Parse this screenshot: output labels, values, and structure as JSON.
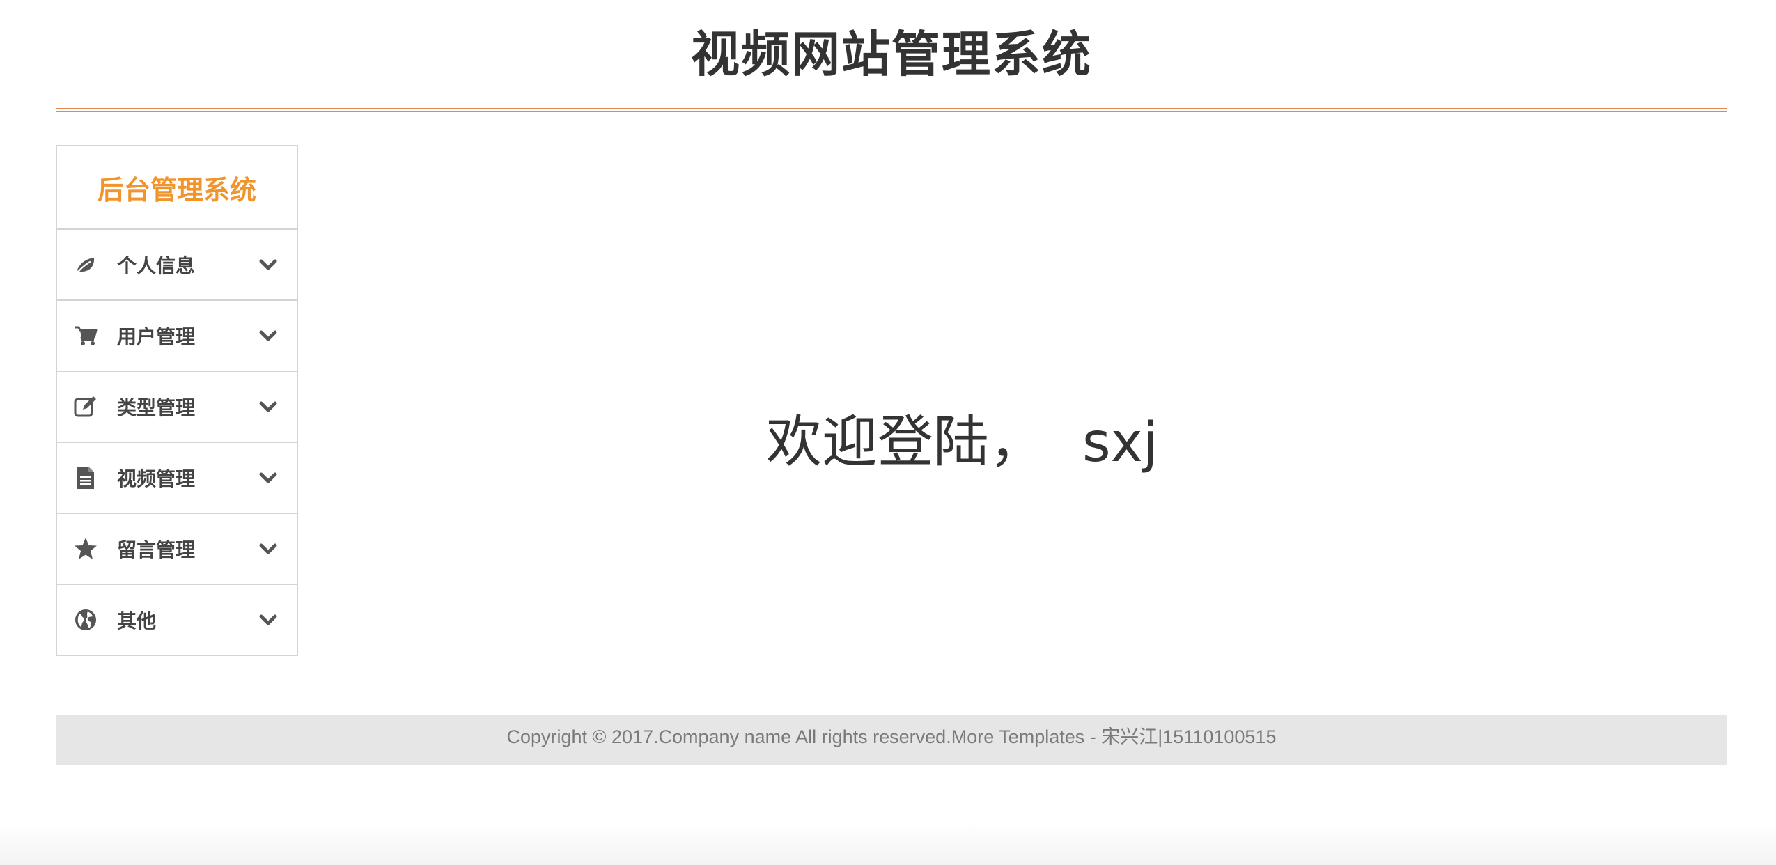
{
  "header": {
    "title": "视频网站管理系统"
  },
  "sidebar": {
    "heading": "后台管理系统",
    "items": [
      {
        "label": "个人信息",
        "icon": "leaf-icon"
      },
      {
        "label": "用户管理",
        "icon": "shopping-cart-icon"
      },
      {
        "label": "类型管理",
        "icon": "edit-icon"
      },
      {
        "label": "视频管理",
        "icon": "file-text-icon"
      },
      {
        "label": "留言管理",
        "icon": "star-icon"
      },
      {
        "label": "其他",
        "icon": "globe-icon"
      }
    ]
  },
  "main": {
    "welcome_text": "欢迎登陆，",
    "username": "sxj"
  },
  "footer": {
    "copyright": "Copyright © 2017.Company name All rights reserved.More Templates - 宋兴江|15110100515"
  },
  "colors": {
    "accent": "#f0952d",
    "header_rule": "#e8874e",
    "footer_bg": "#e6e6e6",
    "icon": "#555555"
  }
}
